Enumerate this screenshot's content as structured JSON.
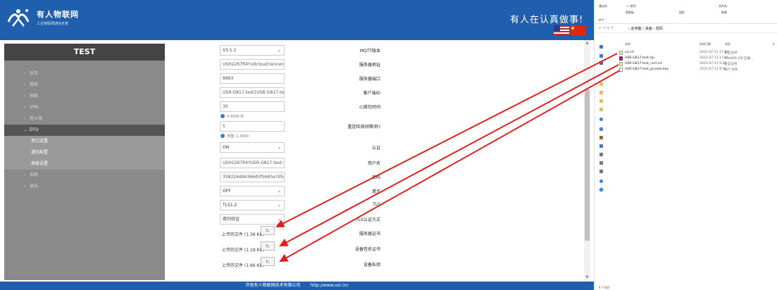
{
  "header": {
    "brand": "有人物联网",
    "brand_sub": "工业物联网通信专家",
    "slogan": "有人在认真做事!"
  },
  "sidebar": {
    "device": "TEST",
    "items": [
      {
        "label": "状态"
      },
      {
        "label": "服务"
      },
      {
        "label": "网络"
      },
      {
        "label": "VPN"
      },
      {
        "label": "防火墙"
      },
      {
        "label": "DTU",
        "expanded": true
      }
    ],
    "sub_items": [
      {
        "label": "串口设置"
      },
      {
        "label": "通信配置"
      },
      {
        "label": "高级设置"
      }
    ],
    "items_after": [
      {
        "label": "系统"
      },
      {
        "label": "退出"
      }
    ]
  },
  "form": {
    "mqtt_version": {
      "label": "MQTT版本",
      "value": "V3.1.1"
    },
    "server_address": {
      "label": "服务器地址",
      "value": "USH2267R4Y.iotcloud.tencent"
    },
    "server_port": {
      "label": "服务器端口",
      "value": "8883"
    },
    "client_id": {
      "label": "客户端ID",
      "value": "USR-G817-test1USB-G817-te"
    },
    "heartbeat": {
      "label": "心跳包时间",
      "value": "30",
      "hint": "0-6000 秒"
    },
    "reconnect": {
      "label": "重连检测间隔(秒)",
      "value": "5",
      "hint": "范围: 1-3600"
    },
    "auth": {
      "label": "认证",
      "value": "ON"
    },
    "username": {
      "label": "用户名",
      "value": "USH2267R4YUSR-G817-test;"
    },
    "password": {
      "label": "密码",
      "value": "358226dd4366d5f5640a7d54"
    },
    "will": {
      "label": "遗言",
      "value": "OFF"
    },
    "tls": {
      "label": "TLS",
      "value": "TLS1.2"
    },
    "tls_mode": {
      "label": "TLS认证方式",
      "value": "双向验证"
    },
    "server_cert": {
      "label": "服务器证书",
      "file_text": "上传的文件 (1.36 KB)"
    },
    "device_cert": {
      "label": "设备签名证书",
      "file_text": "上传的文件 (1.19 KB)"
    },
    "device_key": {
      "label": "设备私钥",
      "file_text": "上传的文件 (1.66 KB)"
    }
  },
  "footer": {
    "company": "济南有人物联网技术有限公司",
    "url": "http://www.usr.cn/"
  },
  "explorer": {
    "ribbon": {
      "cut": "剪切",
      "organize": "组织",
      "new_folder": "文件夹",
      "new": "新建",
      "clipboard": "剪贴板",
      "access": "通达向"
    },
    "breadcrumb": "› 此电脑 › 桌面 › 密码",
    "columns": {
      "name": "名称",
      "date": "修改日期",
      "type": "类型",
      "size": "大"
    },
    "files": [
      {
        "name": "ca.crt",
        "date": "2022-07-11 17:42",
        "type": "安全证书"
      },
      {
        "name": "USR-G817-test.zip",
        "date": "2022-07-11 17:41",
        "type": "WinRAR ZIP 压缩..."
      },
      {
        "name": "USR-G817-test_cert.crt",
        "date": "2022-07-11 9:41",
        "type": "安全证书"
      },
      {
        "name": "USR-G817-test_private.key",
        "date": "2022-07-11 9:41",
        "type": "KEY 文件"
      }
    ],
    "status": "4 个项目"
  },
  "colors": {
    "brand_blue": "#1f5fae",
    "arrow_red": "#e02020"
  }
}
